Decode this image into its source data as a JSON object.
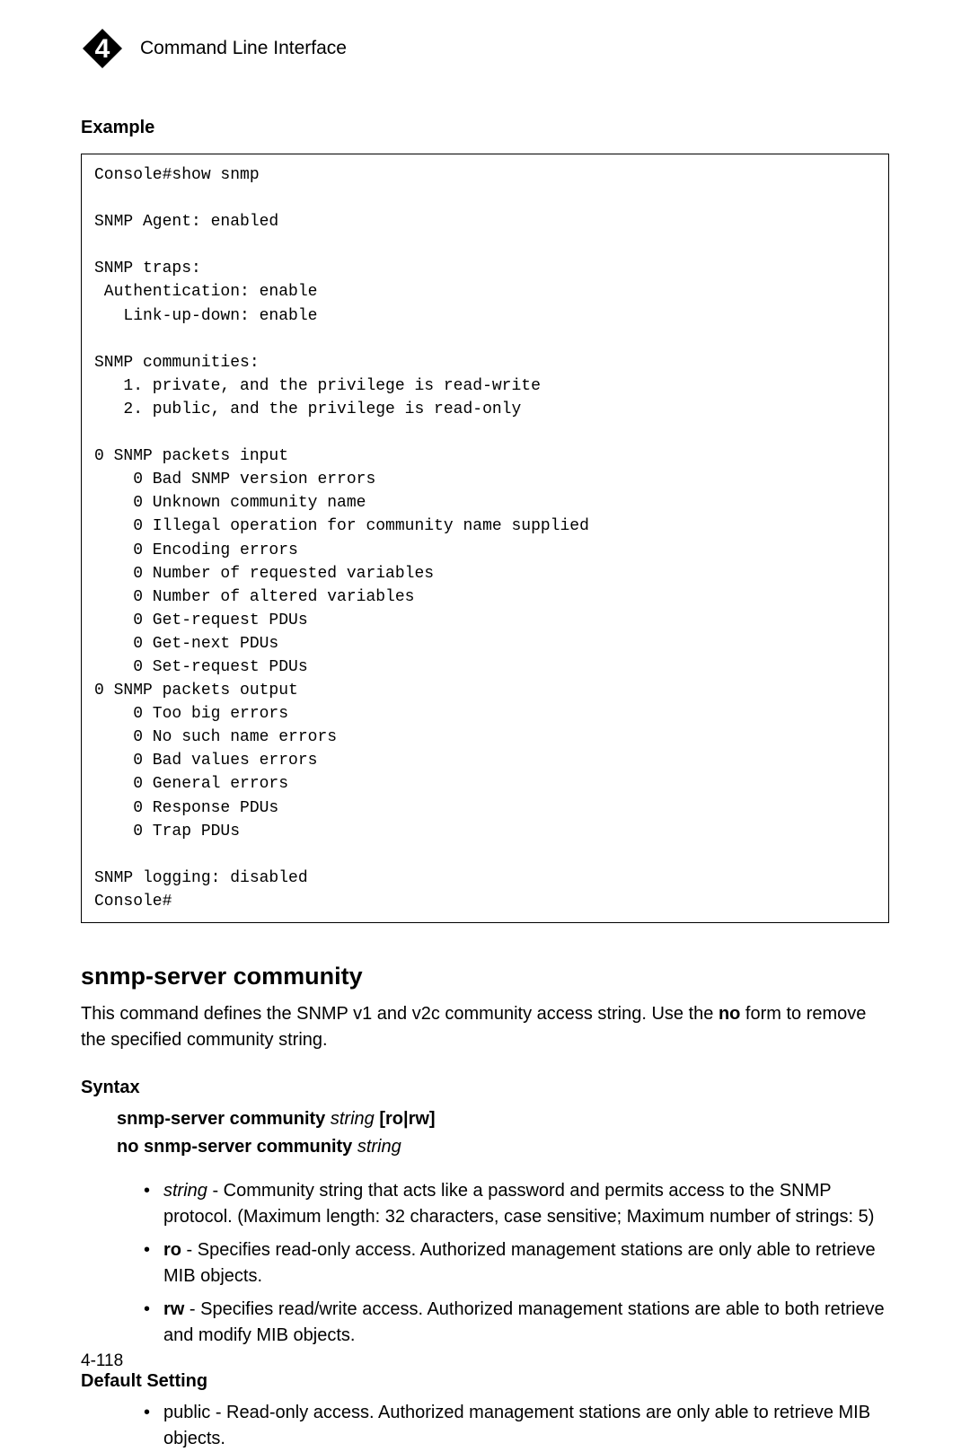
{
  "header": {
    "chapter_number": "4",
    "title": "Command Line Interface"
  },
  "example": {
    "heading": "Example",
    "code": "Console#show snmp\n\nSNMP Agent: enabled\n\nSNMP traps:\n Authentication: enable\n   Link-up-down: enable\n\nSNMP communities:\n   1. private, and the privilege is read-write\n   2. public, and the privilege is read-only\n\n0 SNMP packets input\n    0 Bad SNMP version errors\n    0 Unknown community name\n    0 Illegal operation for community name supplied\n    0 Encoding errors\n    0 Number of requested variables\n    0 Number of altered variables\n    0 Get-request PDUs\n    0 Get-next PDUs\n    0 Set-request PDUs\n0 SNMP packets output\n    0 Too big errors\n    0 No such name errors\n    0 Bad values errors\n    0 General errors\n    0 Response PDUs\n    0 Trap PDUs\n\nSNMP logging: disabled\nConsole#"
  },
  "command": {
    "title": "snmp-server community",
    "description_prefix": "This command defines the SNMP v1 and v2c community access string. Use the ",
    "description_bold": "no",
    "description_suffix": " form to remove the specified community string."
  },
  "syntax": {
    "heading": "Syntax",
    "line1_bold1": "snmp-server community ",
    "line1_italic": "string",
    "line1_bold2": " [ro|rw]",
    "line2_bold": "no snmp-server community ",
    "line2_italic": "string"
  },
  "params": [
    {
      "term_italic": "string",
      "desc": " - Community string that acts like a password and permits access to the SNMP protocol. (Maximum length: 32 characters, case sensitive; Maximum number of strings: 5)"
    },
    {
      "term_bold": "ro",
      "desc": " - Specifies read-only access. Authorized management stations are only able to retrieve MIB objects."
    },
    {
      "term_bold": "rw",
      "desc": " - Specifies read/write access. Authorized management stations are able to both retrieve and modify MIB objects."
    }
  ],
  "default_setting": {
    "heading": "Default Setting",
    "item": "public - Read-only access. Authorized management stations are only able to retrieve MIB objects."
  },
  "page_number": "4-118"
}
